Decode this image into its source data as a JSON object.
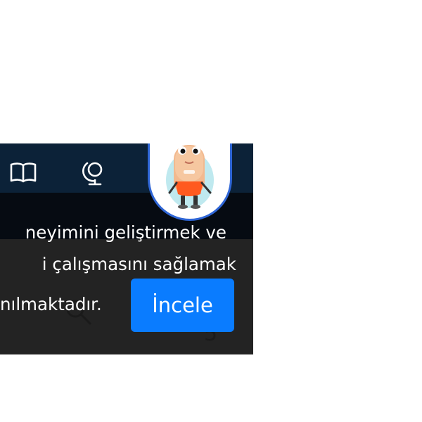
{
  "nav": {
    "icons": [
      "book-icon",
      "globe-icon"
    ]
  },
  "profile": {
    "avatar_icon": "cartoon-character-avatar",
    "border_color": "#2f66d6"
  },
  "cookie_banner": {
    "lines": [
      "neyimini geliştirmek ve",
      "i çalışmasını sağlamak",
      "nılmaktadır."
    ],
    "review_button_label": "İncele",
    "button_color": "#0a7cff"
  },
  "background": {
    "ghost_digit": "5"
  },
  "colors": {
    "nav_bar": "#0c2238",
    "sub_bar": "#060b12",
    "banner": "#232323"
  }
}
